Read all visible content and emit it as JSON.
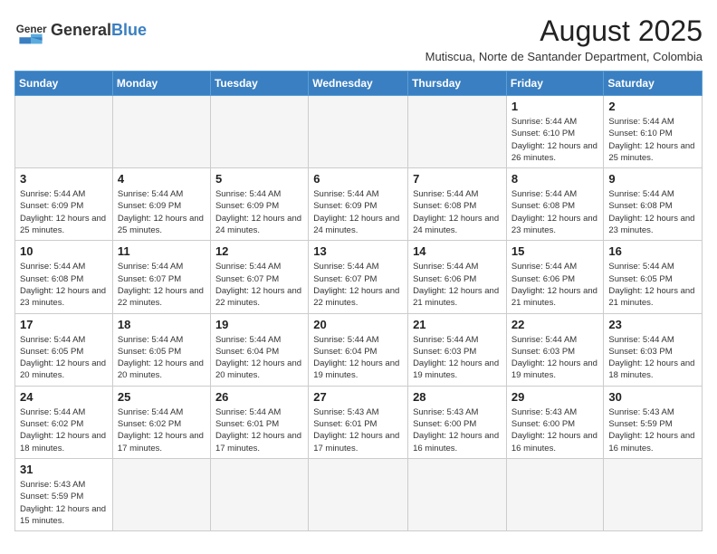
{
  "header": {
    "logo_text_general": "General",
    "logo_text_blue": "Blue",
    "month_year": "August 2025",
    "location": "Mutiscua, Norte de Santander Department, Colombia"
  },
  "weekdays": [
    "Sunday",
    "Monday",
    "Tuesday",
    "Wednesday",
    "Thursday",
    "Friday",
    "Saturday"
  ],
  "weeks": [
    [
      {
        "day": "",
        "info": ""
      },
      {
        "day": "",
        "info": ""
      },
      {
        "day": "",
        "info": ""
      },
      {
        "day": "",
        "info": ""
      },
      {
        "day": "",
        "info": ""
      },
      {
        "day": "1",
        "info": "Sunrise: 5:44 AM\nSunset: 6:10 PM\nDaylight: 12 hours and 26 minutes."
      },
      {
        "day": "2",
        "info": "Sunrise: 5:44 AM\nSunset: 6:10 PM\nDaylight: 12 hours and 25 minutes."
      }
    ],
    [
      {
        "day": "3",
        "info": "Sunrise: 5:44 AM\nSunset: 6:09 PM\nDaylight: 12 hours and 25 minutes."
      },
      {
        "day": "4",
        "info": "Sunrise: 5:44 AM\nSunset: 6:09 PM\nDaylight: 12 hours and 25 minutes."
      },
      {
        "day": "5",
        "info": "Sunrise: 5:44 AM\nSunset: 6:09 PM\nDaylight: 12 hours and 24 minutes."
      },
      {
        "day": "6",
        "info": "Sunrise: 5:44 AM\nSunset: 6:09 PM\nDaylight: 12 hours and 24 minutes."
      },
      {
        "day": "7",
        "info": "Sunrise: 5:44 AM\nSunset: 6:08 PM\nDaylight: 12 hours and 24 minutes."
      },
      {
        "day": "8",
        "info": "Sunrise: 5:44 AM\nSunset: 6:08 PM\nDaylight: 12 hours and 23 minutes."
      },
      {
        "day": "9",
        "info": "Sunrise: 5:44 AM\nSunset: 6:08 PM\nDaylight: 12 hours and 23 minutes."
      }
    ],
    [
      {
        "day": "10",
        "info": "Sunrise: 5:44 AM\nSunset: 6:08 PM\nDaylight: 12 hours and 23 minutes."
      },
      {
        "day": "11",
        "info": "Sunrise: 5:44 AM\nSunset: 6:07 PM\nDaylight: 12 hours and 22 minutes."
      },
      {
        "day": "12",
        "info": "Sunrise: 5:44 AM\nSunset: 6:07 PM\nDaylight: 12 hours and 22 minutes."
      },
      {
        "day": "13",
        "info": "Sunrise: 5:44 AM\nSunset: 6:07 PM\nDaylight: 12 hours and 22 minutes."
      },
      {
        "day": "14",
        "info": "Sunrise: 5:44 AM\nSunset: 6:06 PM\nDaylight: 12 hours and 21 minutes."
      },
      {
        "day": "15",
        "info": "Sunrise: 5:44 AM\nSunset: 6:06 PM\nDaylight: 12 hours and 21 minutes."
      },
      {
        "day": "16",
        "info": "Sunrise: 5:44 AM\nSunset: 6:05 PM\nDaylight: 12 hours and 21 minutes."
      }
    ],
    [
      {
        "day": "17",
        "info": "Sunrise: 5:44 AM\nSunset: 6:05 PM\nDaylight: 12 hours and 20 minutes."
      },
      {
        "day": "18",
        "info": "Sunrise: 5:44 AM\nSunset: 6:05 PM\nDaylight: 12 hours and 20 minutes."
      },
      {
        "day": "19",
        "info": "Sunrise: 5:44 AM\nSunset: 6:04 PM\nDaylight: 12 hours and 20 minutes."
      },
      {
        "day": "20",
        "info": "Sunrise: 5:44 AM\nSunset: 6:04 PM\nDaylight: 12 hours and 19 minutes."
      },
      {
        "day": "21",
        "info": "Sunrise: 5:44 AM\nSunset: 6:03 PM\nDaylight: 12 hours and 19 minutes."
      },
      {
        "day": "22",
        "info": "Sunrise: 5:44 AM\nSunset: 6:03 PM\nDaylight: 12 hours and 19 minutes."
      },
      {
        "day": "23",
        "info": "Sunrise: 5:44 AM\nSunset: 6:03 PM\nDaylight: 12 hours and 18 minutes."
      }
    ],
    [
      {
        "day": "24",
        "info": "Sunrise: 5:44 AM\nSunset: 6:02 PM\nDaylight: 12 hours and 18 minutes."
      },
      {
        "day": "25",
        "info": "Sunrise: 5:44 AM\nSunset: 6:02 PM\nDaylight: 12 hours and 17 minutes."
      },
      {
        "day": "26",
        "info": "Sunrise: 5:44 AM\nSunset: 6:01 PM\nDaylight: 12 hours and 17 minutes."
      },
      {
        "day": "27",
        "info": "Sunrise: 5:43 AM\nSunset: 6:01 PM\nDaylight: 12 hours and 17 minutes."
      },
      {
        "day": "28",
        "info": "Sunrise: 5:43 AM\nSunset: 6:00 PM\nDaylight: 12 hours and 16 minutes."
      },
      {
        "day": "29",
        "info": "Sunrise: 5:43 AM\nSunset: 6:00 PM\nDaylight: 12 hours and 16 minutes."
      },
      {
        "day": "30",
        "info": "Sunrise: 5:43 AM\nSunset: 5:59 PM\nDaylight: 12 hours and 16 minutes."
      }
    ],
    [
      {
        "day": "31",
        "info": "Sunrise: 5:43 AM\nSunset: 5:59 PM\nDaylight: 12 hours and 15 minutes."
      },
      {
        "day": "",
        "info": ""
      },
      {
        "day": "",
        "info": ""
      },
      {
        "day": "",
        "info": ""
      },
      {
        "day": "",
        "info": ""
      },
      {
        "day": "",
        "info": ""
      },
      {
        "day": "",
        "info": ""
      }
    ]
  ]
}
